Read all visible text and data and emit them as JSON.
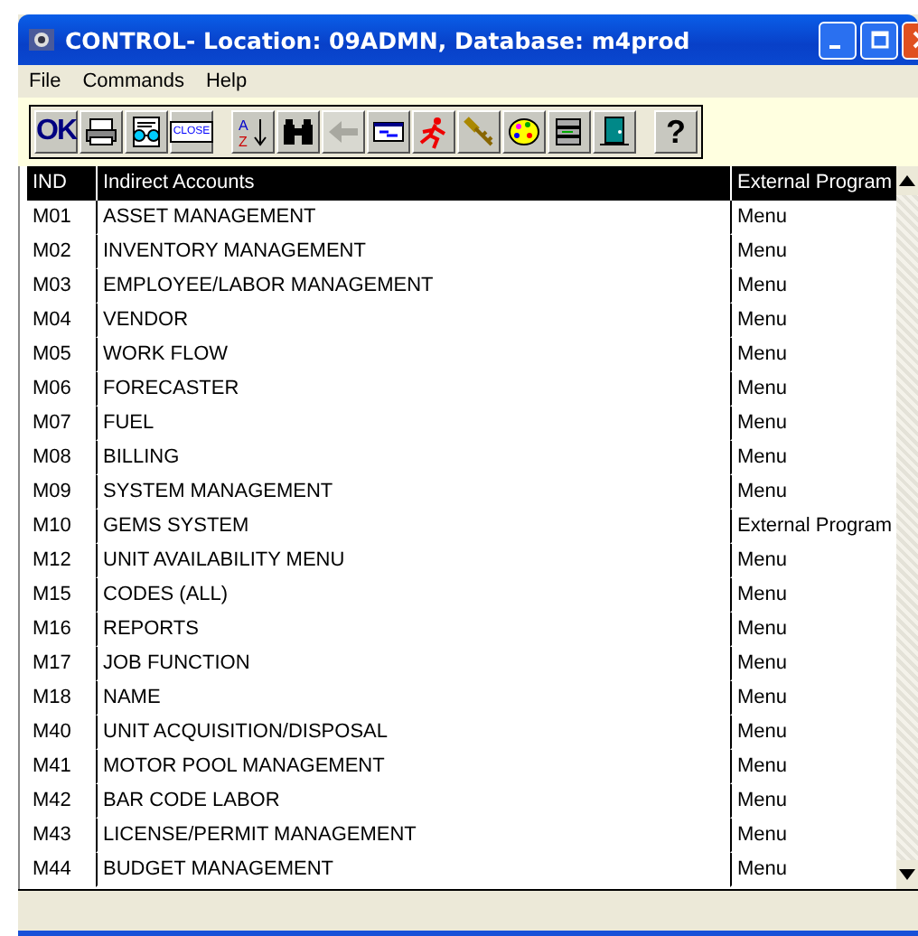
{
  "window": {
    "title": "CONTROL- Location: 09ADMN, Database: m4prod"
  },
  "menu": [
    {
      "label": "File"
    },
    {
      "label": "Commands"
    },
    {
      "label": "Help"
    }
  ],
  "toolbar": [
    {
      "kind": "text",
      "label": "OK",
      "disabled": false
    },
    {
      "kind": "printer",
      "disabled": false
    },
    {
      "kind": "glasses",
      "disabled": false
    },
    {
      "kind": "sign",
      "label": "CLOSE",
      "disabled": false
    },
    {
      "kind": "gap"
    },
    {
      "kind": "sort",
      "letters": [
        "A",
        "Z"
      ],
      "disabled": false
    },
    {
      "kind": "binoculars",
      "disabled": false
    },
    {
      "kind": "arrow",
      "disabled": true
    },
    {
      "kind": "window",
      "disabled": false
    },
    {
      "kind": "runner",
      "disabled": false
    },
    {
      "kind": "key",
      "disabled": false
    },
    {
      "kind": "palette",
      "disabled": false
    },
    {
      "kind": "stack",
      "disabled": false
    },
    {
      "kind": "door",
      "disabled": false
    },
    {
      "kind": "gap"
    },
    {
      "kind": "help",
      "label": "?",
      "disabled": false
    }
  ],
  "table": {
    "columns": [
      "IND",
      "Indirect Accounts",
      "External Program"
    ],
    "rows": [
      [
        "M01",
        "ASSET MANAGEMENT",
        "Menu"
      ],
      [
        "M02",
        "INVENTORY MANAGEMENT",
        "Menu"
      ],
      [
        "M03",
        "EMPLOYEE/LABOR MANAGEMENT",
        "Menu"
      ],
      [
        "M04",
        "VENDOR",
        "Menu"
      ],
      [
        "M05",
        "WORK FLOW",
        "Menu"
      ],
      [
        "M06",
        "FORECASTER",
        "Menu"
      ],
      [
        "M07",
        "FUEL",
        "Menu"
      ],
      [
        "M08",
        "BILLING",
        "Menu"
      ],
      [
        "M09",
        "SYSTEM MANAGEMENT",
        "Menu"
      ],
      [
        "M10",
        "GEMS SYSTEM",
        "External Program"
      ],
      [
        "M12",
        "UNIT AVAILABILITY MENU",
        "Menu"
      ],
      [
        "M15",
        "CODES (ALL)",
        "Menu"
      ],
      [
        "M16",
        "REPORTS",
        "Menu"
      ],
      [
        "M17",
        "JOB FUNCTION",
        "Menu"
      ],
      [
        "M18",
        "NAME",
        "Menu"
      ],
      [
        "M40",
        "UNIT ACQUISITION/DISPOSAL",
        "Menu"
      ],
      [
        "M41",
        "MOTOR POOL MANAGEMENT",
        "Menu"
      ],
      [
        "M42",
        "BAR CODE LABOR",
        "Menu"
      ],
      [
        "M43",
        "LICENSE/PERMIT MANAGEMENT",
        "Menu"
      ],
      [
        "M44",
        "BUDGET MANAGEMENT",
        "Menu"
      ]
    ]
  }
}
